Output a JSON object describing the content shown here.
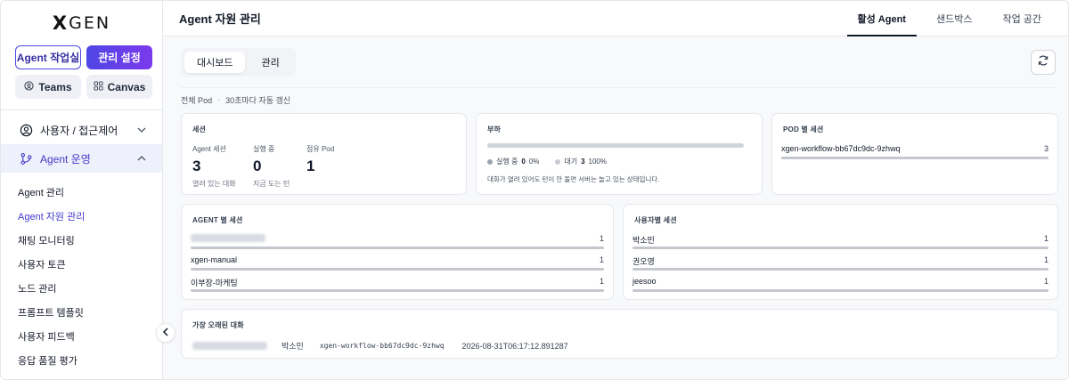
{
  "logo": {
    "x": "X",
    "rest": "GEN"
  },
  "sidebar": {
    "buttons": {
      "agent_studio": "Agent 작업실",
      "admin_settings": "관리 설정",
      "teams": "Teams",
      "canvas": "Canvas"
    },
    "groups": [
      {
        "label": "사용자 / 접근제어",
        "expanded": false
      },
      {
        "label": "Agent 운영",
        "expanded": true
      }
    ],
    "items": [
      {
        "label": "Agent 관리"
      },
      {
        "label": "Agent 자원 관리",
        "selected": true
      },
      {
        "label": "채팅 모니터링"
      },
      {
        "label": "사용자 토큰"
      },
      {
        "label": "노드 관리"
      },
      {
        "label": "프롬프트 템플릿"
      },
      {
        "label": "사용자 피드백"
      },
      {
        "label": "응답 품질 평가"
      }
    ]
  },
  "header": {
    "title": "Agent 자원 관리",
    "tabs": [
      {
        "label": "활성 Agent",
        "active": true
      },
      {
        "label": "샌드박스"
      },
      {
        "label": "작업 공간"
      }
    ]
  },
  "subtabs": [
    {
      "label": "대시보드",
      "active": true
    },
    {
      "label": "관리"
    }
  ],
  "pod_line": {
    "label": "전체 Pod",
    "refresh": "30초마다 자동 갱신"
  },
  "session_card": {
    "title": "세션",
    "metrics": [
      {
        "label": "Agent 세션",
        "value": "3",
        "sub": "열려 있는 대화"
      },
      {
        "label": "실행 중",
        "value": "0",
        "sub": "지금 도는 턴"
      },
      {
        "label": "점유 Pod",
        "value": "1",
        "sub": ""
      }
    ]
  },
  "load_card": {
    "title": "부하",
    "running_label": "실행 중",
    "running_value": "0",
    "running_pct": "0%",
    "waiting_label": "대기",
    "waiting_value": "3",
    "waiting_pct": "100%",
    "note": "대화가 열려 있어도 턴이 안 돌면 서버는 놀고 있는 상태입니다."
  },
  "pod_card": {
    "title": "POD 별 세션",
    "rows": [
      {
        "name": "xgen-workflow-bb67dc9dc-9zhwq",
        "count": "3"
      }
    ]
  },
  "agent_card": {
    "title": "AGENT 별 세션",
    "rows": [
      {
        "name": "",
        "count": "1",
        "redacted": true
      },
      {
        "name": "xgen-manual",
        "count": "1"
      },
      {
        "name": "이부장-마케팅",
        "count": "1"
      }
    ]
  },
  "user_card": {
    "title": "사용자별 세션",
    "rows": [
      {
        "name": "박소민",
        "count": "1"
      },
      {
        "name": "권오영",
        "count": "1"
      },
      {
        "name": "jeesoo",
        "count": "1"
      }
    ]
  },
  "oldest_card": {
    "title": "가장 오래된 대화",
    "user": "박소민",
    "pod": "xgen-workflow-bb67dc9dc-9zhwq",
    "timestamp": "2026-08-31T06:17:12.891287"
  },
  "colors": {
    "accent": "#4f46e5",
    "accent2": "#7c3aed",
    "bar": "#c4c8ce"
  }
}
